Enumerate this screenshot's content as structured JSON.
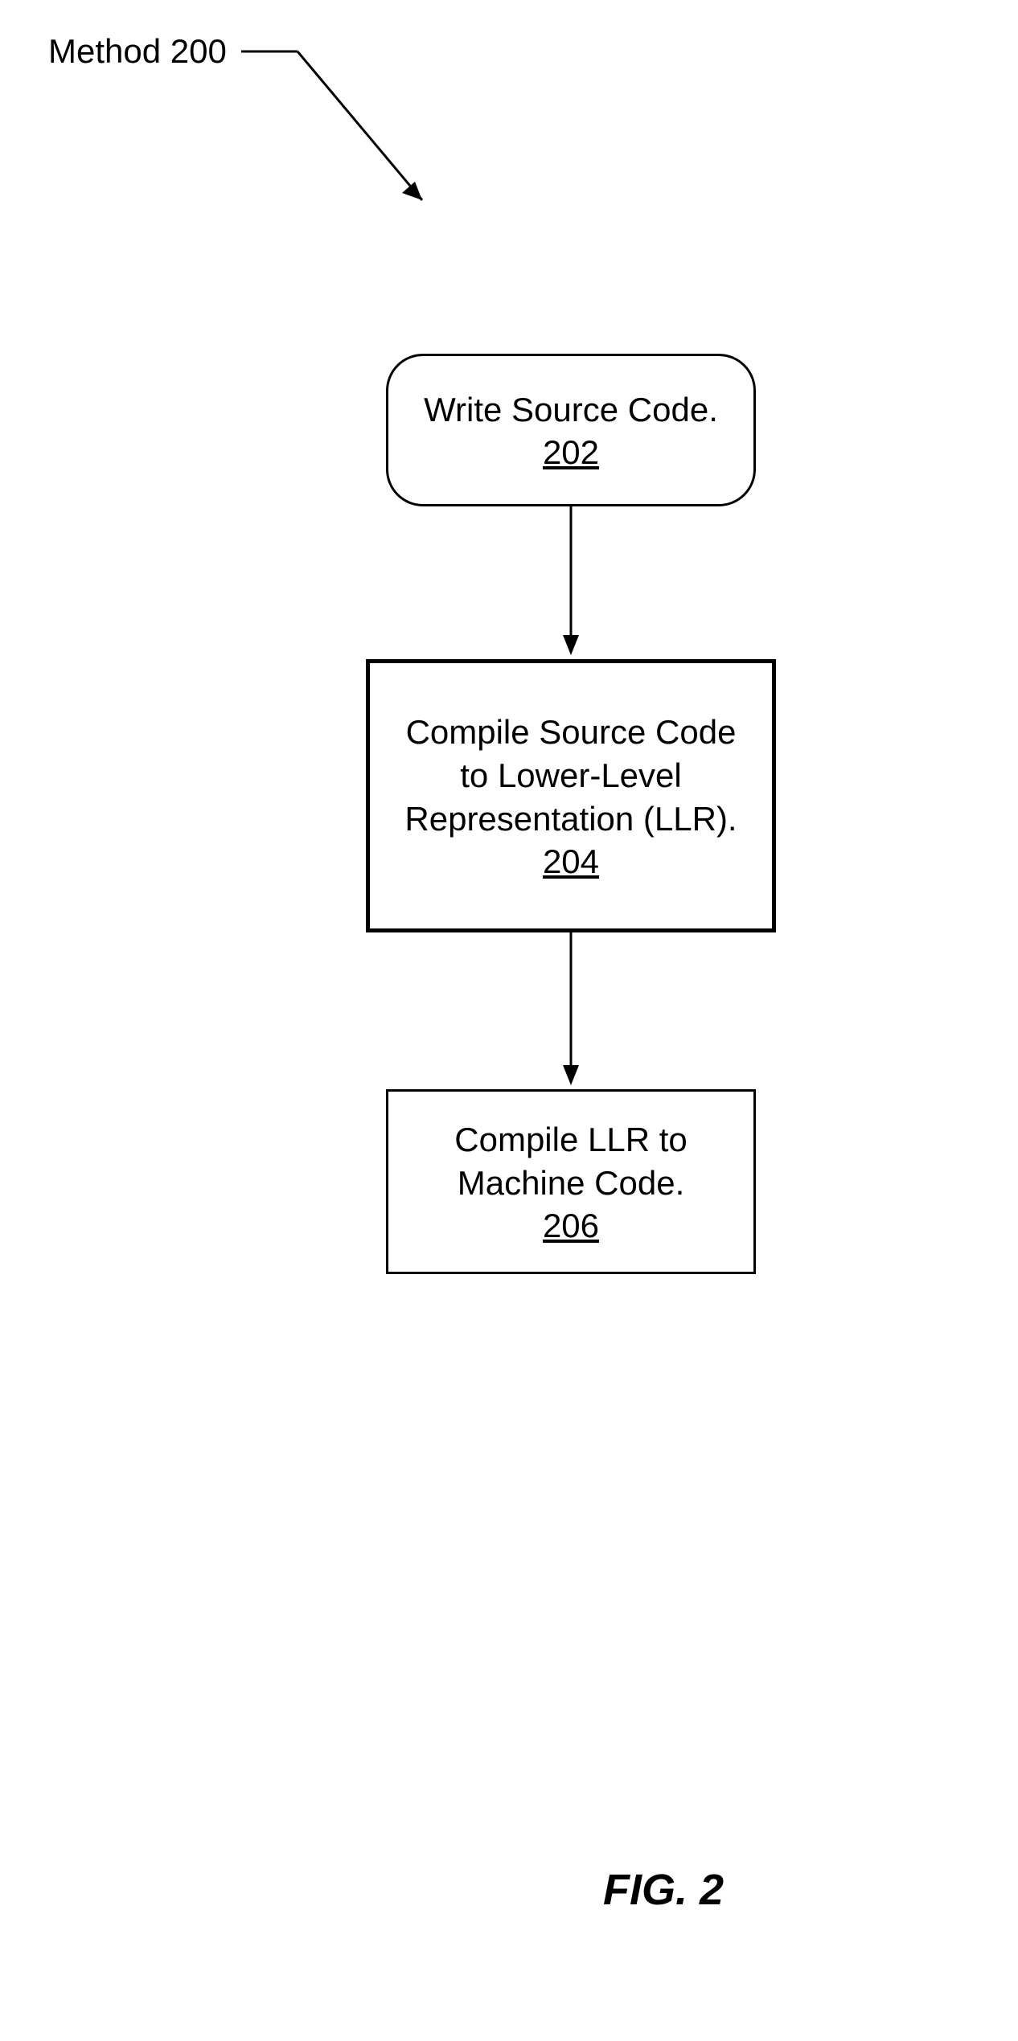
{
  "label": {
    "title": "Method 200"
  },
  "steps": {
    "s1": {
      "text": "Write Source Code.",
      "num": "202"
    },
    "s2": {
      "text": "Compile Source Code to Lower-Level Representation (LLR).",
      "num": "204"
    },
    "s3": {
      "text": "Compile LLR to Machine Code.",
      "num": "206"
    }
  },
  "figure": {
    "caption": "FIG. 2"
  }
}
